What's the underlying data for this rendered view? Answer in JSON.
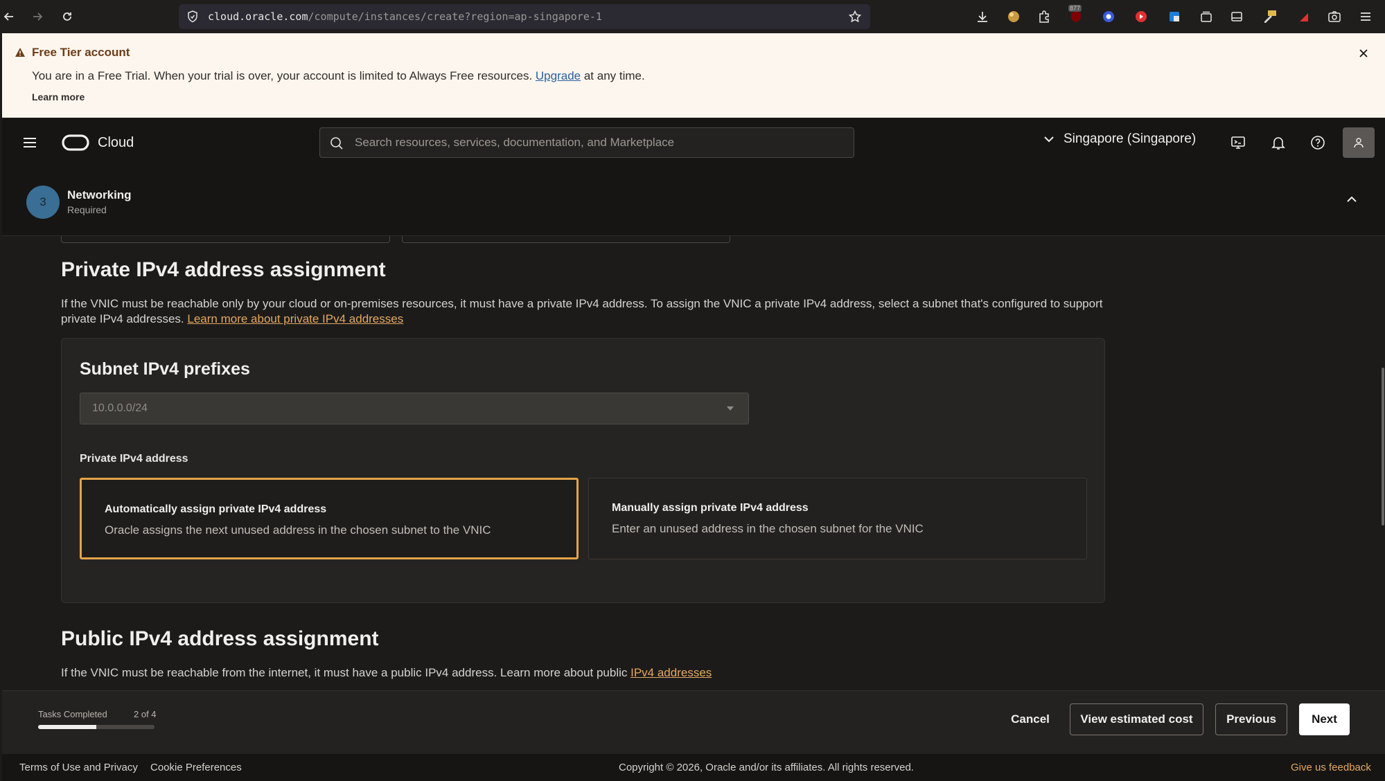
{
  "browser": {
    "url_host": "cloud.oracle.com",
    "url_path": "/compute/instances/create?region=ap-singapore-1",
    "extension_badge": "877"
  },
  "banner": {
    "title": "Free Tier account",
    "message_before": "You are in a Free Trial. When your trial is over, your account is limited to Always Free resources. ",
    "upgrade_link": "Upgrade",
    "message_after": " at any time.",
    "learn_more": "Learn more"
  },
  "header": {
    "brand": "Cloud",
    "search_placeholder": "Search resources, services, documentation, and Marketplace",
    "region": "Singapore (Singapore)"
  },
  "step": {
    "number": "3",
    "title": "Networking",
    "subtitle": "Required"
  },
  "private_section": {
    "title": "Private IPv4 address assignment",
    "description": "If the VNIC must be reachable only by your cloud or on-premises resources, it must have a private IPv4 address. To assign the VNIC a private IPv4 address, select a subnet that's configured to support private IPv4 addresses. ",
    "learn_link": "Learn more about private IPv4 addresses",
    "subnet_title": "Subnet IPv4 prefixes",
    "subnet_value": "10.0.0.0/24",
    "address_label": "Private IPv4 address",
    "options": [
      {
        "title": "Automatically assign private IPv4 address",
        "description": "Oracle assigns the next unused address in the chosen subnet to the VNIC",
        "selected": true
      },
      {
        "title": "Manually assign private IPv4 address",
        "description": "Enter an unused address in the chosen subnet for the VNIC",
        "selected": false
      }
    ]
  },
  "public_section": {
    "title": "Public IPv4 address assignment",
    "description": "If the VNIC must be reachable from the internet, it must have a public IPv4 address. Learn more about public ",
    "link": "IPv4 addresses"
  },
  "footer_bar": {
    "tasks_label": "Tasks Completed",
    "tasks_count": "2 of 4",
    "progress_fraction": 0.5,
    "cancel": "Cancel",
    "estimate": "View estimated cost",
    "previous": "Previous",
    "next": "Next"
  },
  "page_footer": {
    "terms": "Terms of Use and Privacy",
    "cookies": "Cookie Preferences",
    "copyright": "Copyright © 2026, Oracle and/or its affiliates. All rights reserved.",
    "feedback": "Give us feedback"
  },
  "colors": {
    "accent": "#e4a44a",
    "link": "#e4a863",
    "banner_bg": "#fcf6ee",
    "step_circle": "#3a6e94"
  }
}
